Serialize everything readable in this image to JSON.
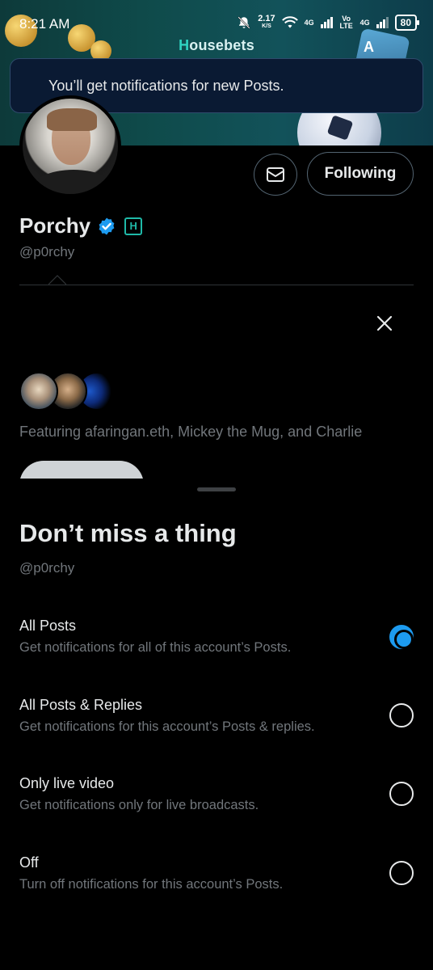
{
  "status_bar": {
    "time": "8:21 AM",
    "speed_value": "2.17",
    "speed_unit": "K/S",
    "network1": "4G",
    "network_volte": "Vo LTE",
    "network2": "4G",
    "battery": "80"
  },
  "banner": {
    "brand_prefix": "H",
    "brand_rest": "ousebets",
    "card_letter": "A"
  },
  "toast": {
    "message": "You’ll get notifications for new Posts."
  },
  "profile": {
    "following_label": "Following",
    "name": "Porchy",
    "badge_letter": "H",
    "handle": "@p0rchy",
    "featuring": "Featuring afaringan.eth, Mickey the Mug, and Charlie"
  },
  "sheet": {
    "title": "Don’t miss a thing",
    "handle": "@p0rchy",
    "options": [
      {
        "label": "All Posts",
        "description": "Get notifications for all of this account’s Posts.",
        "selected": true
      },
      {
        "label": "All Posts & Replies",
        "description": "Get notifications for this account’s Posts & replies.",
        "selected": false
      },
      {
        "label": "Only live video",
        "description": "Get notifications only for live broadcasts.",
        "selected": false
      },
      {
        "label": "Off",
        "description": "Turn off notifications for this account’s Posts.",
        "selected": false
      }
    ]
  },
  "colors": {
    "accent": "#1d9bf0",
    "badge": "#1fb9a8",
    "secondary_text": "#71767b"
  }
}
